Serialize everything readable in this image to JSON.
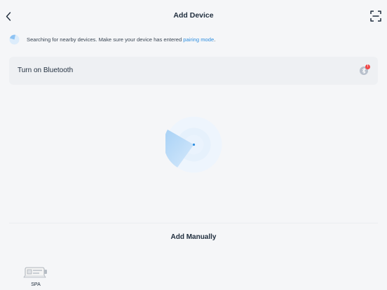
{
  "header": {
    "title": "Add Device",
    "back_icon": "chevron-left-icon",
    "scan_icon": "scan-frame-icon"
  },
  "search": {
    "message": "Searching for nearby devices. Make sure your device has entered ",
    "link": "pairing mode",
    "suffix": ".",
    "icon": "radar-mini-icon"
  },
  "bluetooth": {
    "label": "Turn on Bluetooth",
    "icon": "bluetooth-icon",
    "badge": "!"
  },
  "manual": {
    "title": "Add Manually"
  },
  "devices": [
    {
      "label": "SPA",
      "icon": "spa-device-icon"
    }
  ],
  "colors": {
    "background": "#f5f6f8",
    "accent": "#2f8fe0",
    "card": "#eef0f3",
    "badge": "#f04646"
  }
}
